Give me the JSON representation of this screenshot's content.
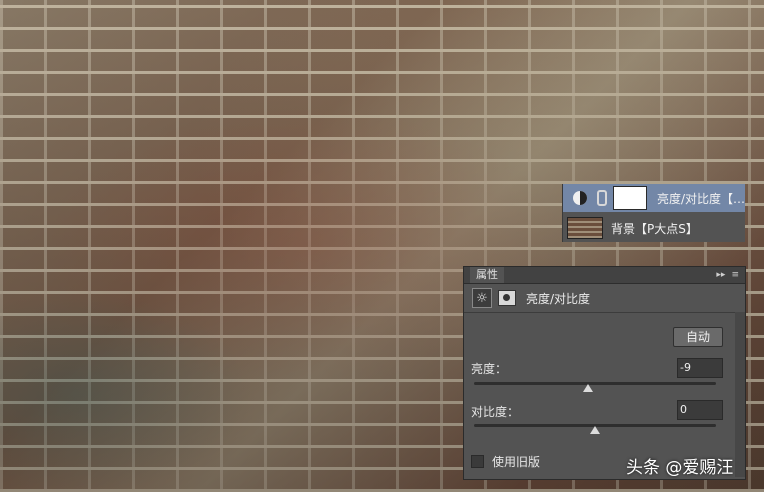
{
  "canvas": {
    "description_icon": "brick-wall-photo"
  },
  "layers": {
    "adjustment_layer": {
      "name": "亮度/对比度【…",
      "icon": "brightness-contrast-adjustment-icon"
    },
    "background_layer": {
      "name": "背景【P大点S】"
    }
  },
  "properties": {
    "tab_title": "属性",
    "collapse_icon": "▸▸",
    "menu_icon": "≡",
    "adjustment_name": "亮度/对比度",
    "auto_label": "自动",
    "brightness": {
      "label": "亮度：",
      "value": "-9",
      "fraction": 0.47
    },
    "contrast": {
      "label": "对比度：",
      "value": "0",
      "fraction": 0.5
    },
    "legacy_label": "使用旧版",
    "legacy_checked": false
  },
  "watermark": {
    "text": "头条 @爱赐汪"
  },
  "colors": {
    "selected_layer": "#7387a7",
    "panel_bg": "#535353",
    "input_bg": "#3b3b3b"
  }
}
